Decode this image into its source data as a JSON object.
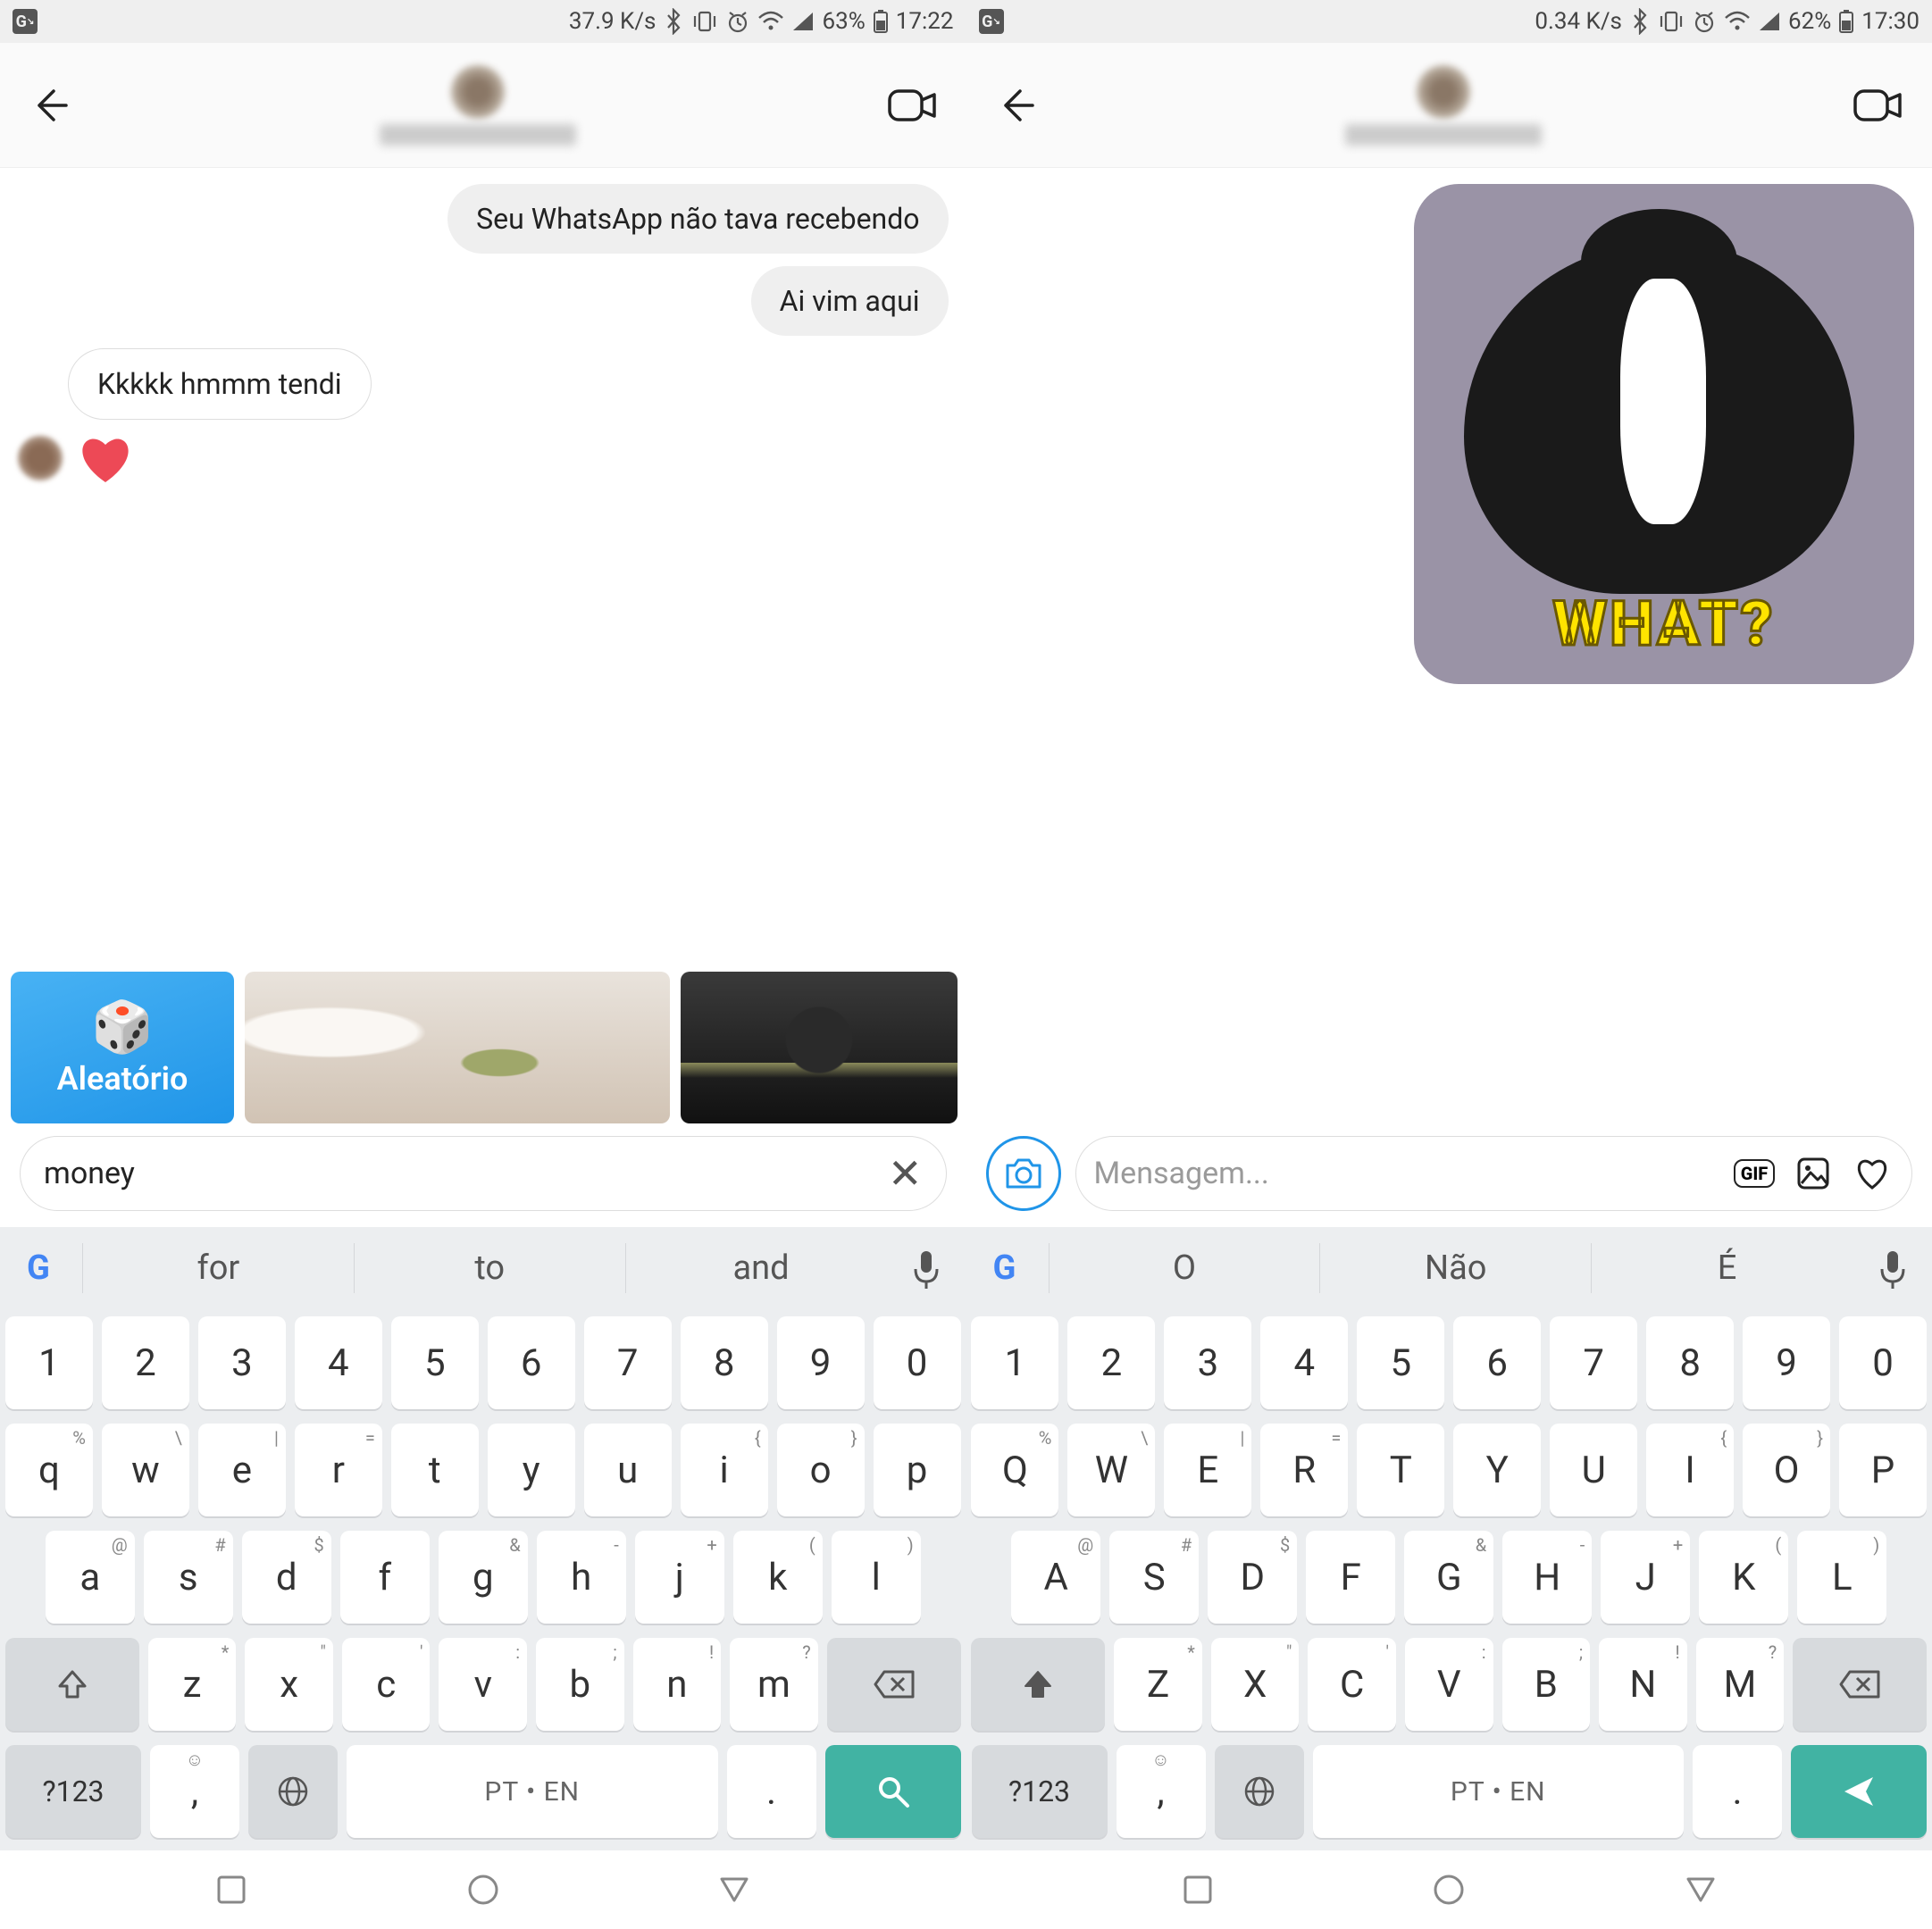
{
  "left": {
    "status": {
      "speed": "37.9 K/s",
      "battery": "63%",
      "time": "17:22"
    },
    "messages": {
      "m1": "Seu WhatsApp não tava recebendo",
      "m2": "Ai vim aqui",
      "m3": "Kkkkk hmmm tendi"
    },
    "gif_strip": {
      "random_label": "Aleatório"
    },
    "search": {
      "value": "money"
    },
    "suggestions": {
      "s1": "for",
      "s2": "to",
      "s3": "and"
    },
    "keyboard": {
      "row_num": [
        "1",
        "2",
        "3",
        "4",
        "5",
        "6",
        "7",
        "8",
        "9",
        "0"
      ],
      "row_a": [
        "q",
        "w",
        "e",
        "r",
        "t",
        "y",
        "u",
        "i",
        "o",
        "p"
      ],
      "row_a_hint": [
        "%",
        "\\",
        "|",
        "=",
        "",
        "",
        "",
        "{",
        "}",
        ""
      ],
      "row_b": [
        "a",
        "s",
        "d",
        "f",
        "g",
        "h",
        "j",
        "k",
        "l"
      ],
      "row_b_hint": [
        "@",
        "#",
        "$",
        "",
        "&",
        "-",
        "+",
        "(",
        ")"
      ],
      "row_c": [
        "z",
        "x",
        "c",
        "v",
        "b",
        "n",
        "m"
      ],
      "row_c_hint": [
        "*",
        "\"",
        "'",
        ":",
        ";",
        "!",
        "?"
      ],
      "sym": "?123",
      "space": "PT • EN",
      "period": "."
    }
  },
  "right": {
    "status": {
      "speed": "0.34 K/s",
      "battery": "62%",
      "time": "17:30"
    },
    "sent_gif_caption": "WHAT?",
    "compose": {
      "placeholder": "Mensagem...",
      "gif_label": "GIF"
    },
    "suggestions": {
      "s1": "O",
      "s2": "Não",
      "s3": "É"
    },
    "keyboard": {
      "row_num": [
        "1",
        "2",
        "3",
        "4",
        "5",
        "6",
        "7",
        "8",
        "9",
        "0"
      ],
      "row_a": [
        "Q",
        "W",
        "E",
        "R",
        "T",
        "Y",
        "U",
        "I",
        "O",
        "P"
      ],
      "row_a_hint": [
        "%",
        "\\",
        "|",
        "=",
        "",
        "",
        "",
        "{",
        "}",
        ""
      ],
      "row_b": [
        "A",
        "S",
        "D",
        "F",
        "G",
        "H",
        "J",
        "K",
        "L"
      ],
      "row_b_hint": [
        "@",
        "#",
        "$",
        "",
        "&",
        "-",
        "+",
        "(",
        ")"
      ],
      "row_c": [
        "Z",
        "X",
        "C",
        "V",
        "B",
        "N",
        "M"
      ],
      "row_c_hint": [
        "*",
        "\"",
        "'",
        ":",
        ";",
        "!",
        "?"
      ],
      "sym": "?123",
      "space": "PT • EN",
      "period": "."
    }
  }
}
